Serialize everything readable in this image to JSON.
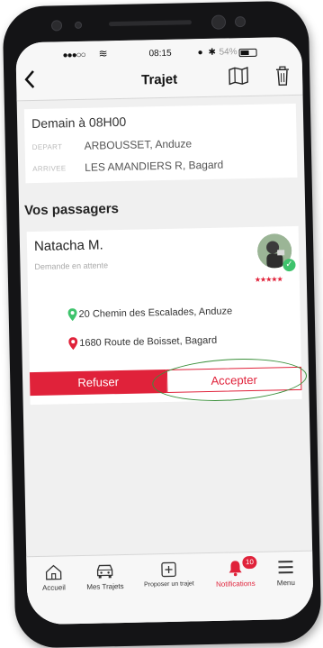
{
  "statusbar": {
    "carrier": "●●●○○",
    "time": "08:15",
    "battery": "54%"
  },
  "navbar": {
    "back_icon": "chevron-left-icon",
    "title": "Trajet",
    "map_icon": "map-icon",
    "trash_icon": "trash-icon"
  },
  "trip": {
    "time": "Demain à 08H00",
    "depart_label": "DEPART",
    "depart_value": "ARBOUSSET, Anduze",
    "arrivee_label": "ARRIVEE",
    "arrivee_value": "LES AMANDIERS R, Bagard"
  },
  "passengers": {
    "section_title": "Vos passagers",
    "items": [
      {
        "name": "Natacha M.",
        "status": "Demande en attente",
        "rating_stars": "★★★★★",
        "pickup": "20 Chemin des Escalades, Anduze",
        "dropoff": "1680 Route de Boisset, Bagard",
        "refuse_label": "Refuser",
        "accept_label": "Accepter"
      }
    ]
  },
  "tabbar": {
    "items": [
      {
        "label": "Accueil",
        "icon": "home-icon"
      },
      {
        "label": "Mes Trajets",
        "icon": "car-icon"
      },
      {
        "label": "Proposer un trajet",
        "icon": "plus-square-icon"
      },
      {
        "label": "Notifications",
        "icon": "bell-icon",
        "badge": "10",
        "active": true
      },
      {
        "label": "Menu",
        "icon": "menu-icon"
      }
    ]
  },
  "colors": {
    "accent": "#e0223a",
    "pin_green": "#3ec36c",
    "annotation_green": "#3a8f3a"
  }
}
